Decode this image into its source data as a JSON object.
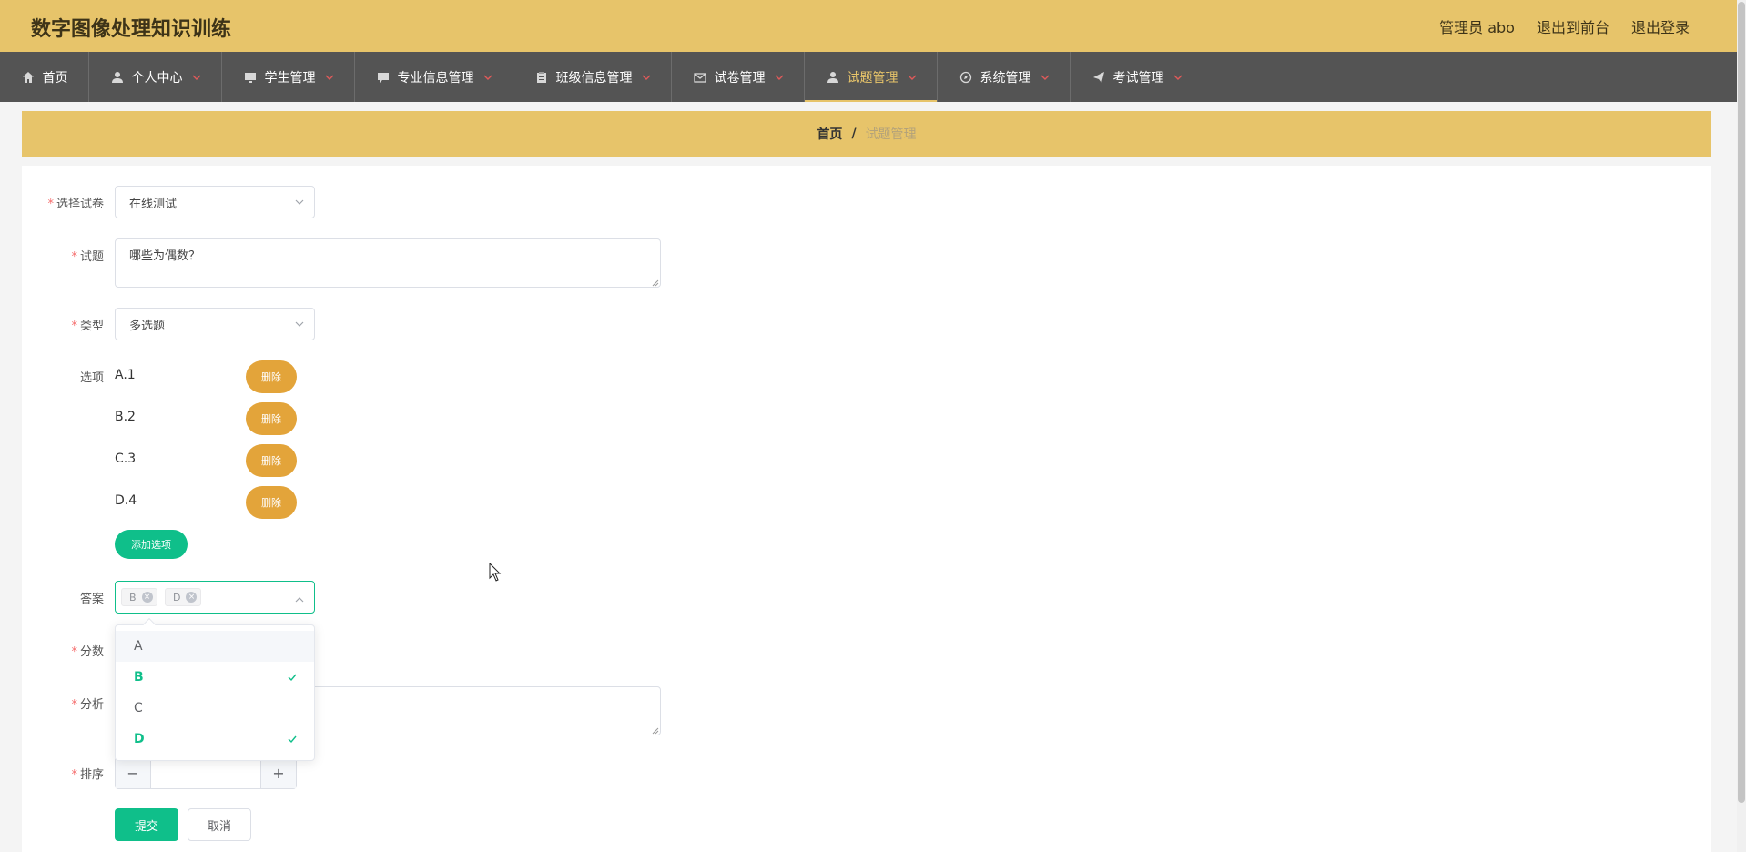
{
  "app": {
    "title": "数字图像处理知识训练"
  },
  "top_links": {
    "user": "管理员 abo",
    "to_front": "退出到前台",
    "logout": "退出登录"
  },
  "nav": {
    "items": [
      {
        "label": "首页",
        "icon": "home-icon"
      },
      {
        "label": "个人中心",
        "icon": "user-icon"
      },
      {
        "label": "学生管理",
        "icon": "monitor-icon"
      },
      {
        "label": "专业信息管理",
        "icon": "chat-icon"
      },
      {
        "label": "班级信息管理",
        "icon": "clipboard-icon"
      },
      {
        "label": "试卷管理",
        "icon": "mail-icon"
      },
      {
        "label": "试题管理",
        "icon": "user-icon"
      },
      {
        "label": "系统管理",
        "icon": "compass-icon"
      },
      {
        "label": "考试管理",
        "icon": "send-icon"
      }
    ],
    "active": "试题管理"
  },
  "breadcrumb": {
    "home": "首页",
    "separator": "/",
    "current": "试题管理"
  },
  "form": {
    "paper": {
      "label": "选择试卷",
      "value": "在线测试"
    },
    "question": {
      "label": "试题",
      "value": "哪些为偶数？"
    },
    "type": {
      "label": "类型",
      "value": "多选题"
    },
    "options": {
      "label": "选项",
      "items": [
        "A.1",
        "B.2",
        "C.3",
        "D.4"
      ],
      "delete_label": "删除",
      "add_label": "添加选项"
    },
    "answer": {
      "label": "答案",
      "tags": [
        "B",
        "D"
      ],
      "dropdown": [
        {
          "label": "A",
          "selected": false
        },
        {
          "label": "B",
          "selected": true
        },
        {
          "label": "C",
          "selected": false
        },
        {
          "label": "D",
          "selected": true
        }
      ]
    },
    "score": {
      "label": "分数"
    },
    "analysis": {
      "label": "分析"
    },
    "order": {
      "label": "排序",
      "minus": "−",
      "plus": "+"
    },
    "submit_label": "提交",
    "cancel_label": "取消"
  },
  "colors": {
    "header": "#e7c46a",
    "nav": "#545454",
    "accent": "#0fbf8a",
    "delete": "#e3a43a"
  }
}
